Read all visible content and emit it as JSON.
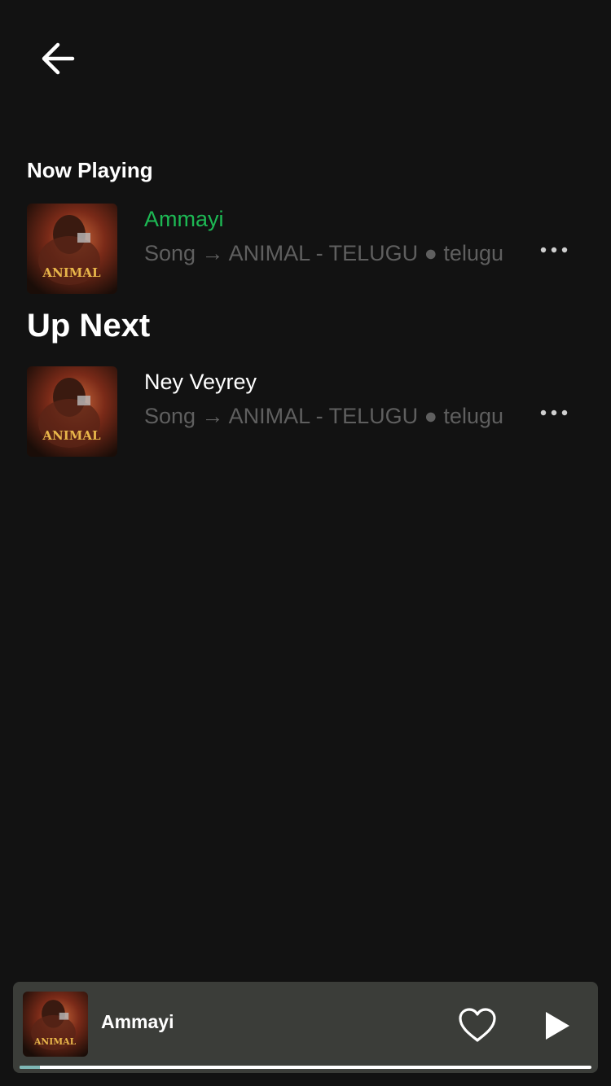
{
  "header": {
    "back_icon": "arrow-left-icon"
  },
  "now_playing": {
    "section_label": "Now Playing",
    "track": {
      "title": "Ammayi",
      "subtitle": "Song → ANIMAL - TELUGU ● telugu",
      "cover_text": "ANIMAL",
      "more_icon": "more-horizontal-icon"
    }
  },
  "up_next": {
    "section_label": "Up Next",
    "tracks": [
      {
        "title": "Ney Veyrey",
        "subtitle": "Song → ANIMAL - TELUGU ● telugu",
        "cover_text": "ANIMAL",
        "more_icon": "more-horizontal-icon"
      }
    ]
  },
  "mini_player": {
    "title": "Ammayi",
    "cover_text": "ANIMAL",
    "like_icon": "heart-outline-icon",
    "play_icon": "play-icon",
    "progress": 0.035
  },
  "colors": {
    "background": "#121212",
    "accent_green": "#1db954",
    "subtitle_gray": "#5f5f5f",
    "mini_player_bg": "#3b3d39",
    "progress_fill": "#7fb8b6"
  }
}
